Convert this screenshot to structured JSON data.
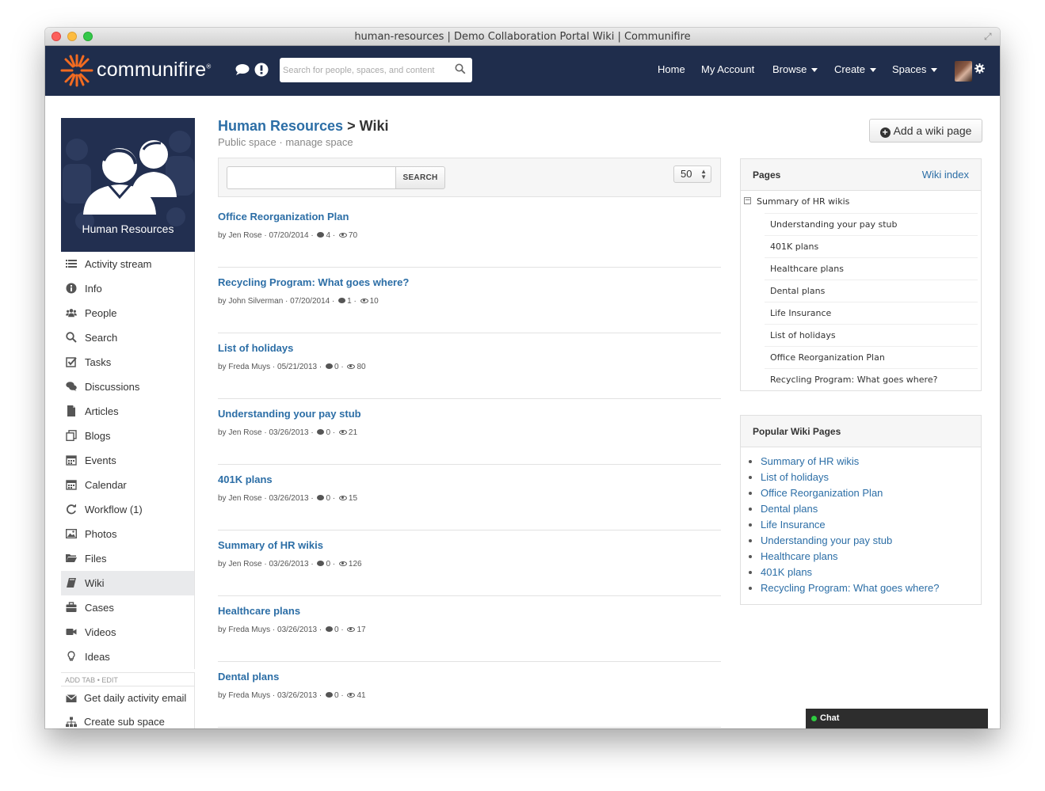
{
  "window": {
    "title": "human-resources | Demo Collaboration Portal Wiki | Communifire"
  },
  "topnav": {
    "logo_text": "communifire",
    "logo_mark": "®",
    "search_placeholder": "Search for people, spaces, and content",
    "items": [
      {
        "label": "Home"
      },
      {
        "label": "My Account"
      },
      {
        "label": "Browse"
      },
      {
        "label": "Create"
      },
      {
        "label": "Spaces"
      }
    ],
    "brand_color": "#1f2d4c",
    "accent_color": "#f26b21"
  },
  "space": {
    "name": "Human Resources"
  },
  "sidebar": {
    "items": [
      {
        "label": "Activity stream",
        "icon": "list-icon"
      },
      {
        "label": "Info",
        "icon": "info-icon"
      },
      {
        "label": "People",
        "icon": "people-icon"
      },
      {
        "label": "Search",
        "icon": "search-icon"
      },
      {
        "label": "Tasks",
        "icon": "checkbox-icon"
      },
      {
        "label": "Discussions",
        "icon": "comments-icon"
      },
      {
        "label": "Articles",
        "icon": "document-icon"
      },
      {
        "label": "Blogs",
        "icon": "blog-icon"
      },
      {
        "label": "Events",
        "icon": "calendar-icon"
      },
      {
        "label": "Calendar",
        "icon": "calendar-icon"
      },
      {
        "label": "Workflow (1)",
        "icon": "refresh-icon"
      },
      {
        "label": "Photos",
        "icon": "image-icon"
      },
      {
        "label": "Files",
        "icon": "folder-icon"
      },
      {
        "label": "Wiki",
        "icon": "book-icon"
      },
      {
        "label": "Cases",
        "icon": "briefcase-icon"
      },
      {
        "label": "Videos",
        "icon": "video-icon"
      },
      {
        "label": "Ideas",
        "icon": "lightbulb-icon"
      }
    ],
    "add_tab": "ADD TAB",
    "edit": "EDIT",
    "extra": [
      {
        "label": "Get daily activity email",
        "icon": "envelope-icon"
      },
      {
        "label": "Create sub space",
        "icon": "sitemap-icon"
      }
    ]
  },
  "main": {
    "breadcrumb": {
      "parent": "Human Resources",
      "sep": ">",
      "current": "Wiki"
    },
    "subtitle": {
      "type": "Public space",
      "dot": "·",
      "manage": "manage space"
    },
    "add_button": "Add a wiki page",
    "search_button": "SEARCH",
    "per_page": "50",
    "articles": [
      {
        "title": "Office Reorganization Plan",
        "author": "Jen Rose",
        "date": "07/20/2014",
        "comments": "4",
        "views": "70"
      },
      {
        "title": "Recycling Program: What goes where?",
        "author": "John Silverman",
        "date": "07/20/2014",
        "comments": "1",
        "views": "10"
      },
      {
        "title": "List of holidays",
        "author": "Freda Muys",
        "date": "05/21/2013",
        "comments": "0",
        "views": "80"
      },
      {
        "title": "Understanding your pay stub",
        "author": "Jen Rose",
        "date": "03/26/2013",
        "comments": "0",
        "views": "21"
      },
      {
        "title": "401K plans",
        "author": "Jen Rose",
        "date": "03/26/2013",
        "comments": "0",
        "views": "15"
      },
      {
        "title": "Summary of HR wikis",
        "author": "Jen Rose",
        "date": "03/26/2013",
        "comments": "0",
        "views": "126"
      },
      {
        "title": "Healthcare plans",
        "author": "Freda Muys",
        "date": "03/26/2013",
        "comments": "0",
        "views": "17"
      },
      {
        "title": "Dental plans",
        "author": "Freda Muys",
        "date": "03/26/2013",
        "comments": "0",
        "views": "41"
      }
    ]
  },
  "pages_panel": {
    "title": "Pages",
    "link": "Wiki index",
    "root": "Summary of HR wikis",
    "children": [
      "Understanding your pay stub",
      "401K plans",
      "Healthcare plans",
      "Dental plans",
      "Life Insurance",
      "List of holidays",
      "Office Reorganization Plan",
      "Recycling Program: What goes where?"
    ]
  },
  "popular_panel": {
    "title": "Popular Wiki Pages",
    "items": [
      "Summary of HR wikis",
      "List of holidays",
      "Office Reorganization Plan",
      "Dental plans",
      "Life Insurance",
      "Understanding your pay stub",
      "Healthcare plans",
      "401K plans",
      "Recycling Program: What goes where?"
    ]
  },
  "chat": {
    "label": "Chat",
    "status_color": "#2ecc40"
  }
}
